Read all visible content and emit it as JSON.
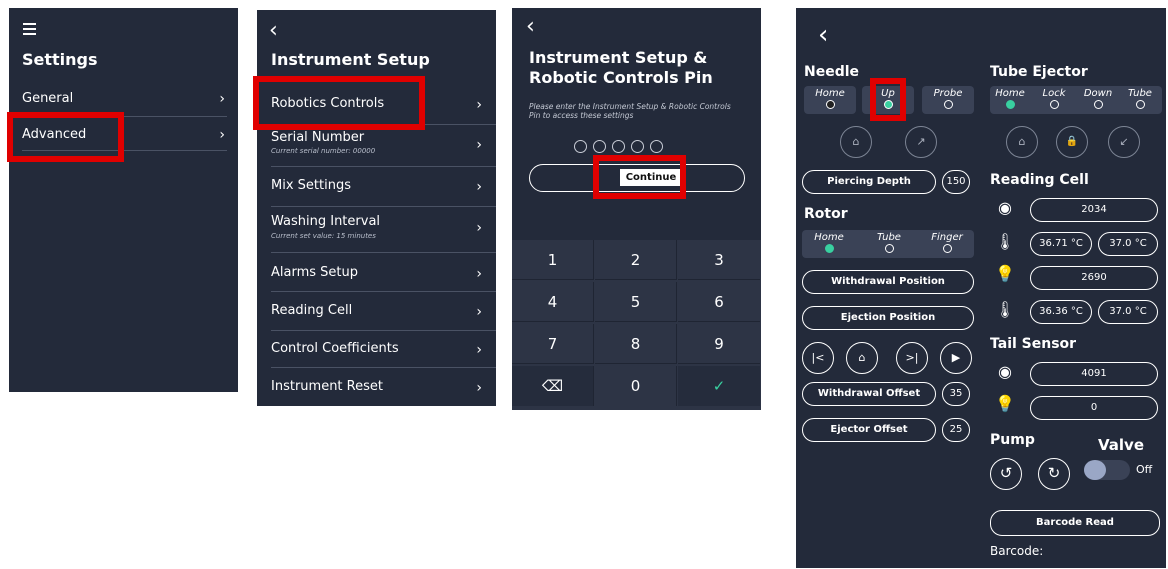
{
  "settings_screen": {
    "menu_icon": "hamburger-icon",
    "title": "Settings",
    "items": [
      {
        "label": "General",
        "chevron": "›"
      },
      {
        "label": "Advanced",
        "chevron": "›"
      }
    ]
  },
  "instrument_setup": {
    "back": "‹",
    "title": "Instrument Setup",
    "items": [
      {
        "label": "Robotics Controls",
        "sub": "",
        "chevron": "›"
      },
      {
        "label": "Serial Number",
        "sub": "Current serial number: 00000",
        "chevron": "›"
      },
      {
        "label": "Mix Settings",
        "sub": "",
        "chevron": "›"
      },
      {
        "label": "Washing Interval",
        "sub": "Current set value: 15 minutes",
        "chevron": "›"
      },
      {
        "label": "Alarms Setup",
        "sub": "",
        "chevron": "›"
      },
      {
        "label": "Reading Cell",
        "sub": "",
        "chevron": "›"
      },
      {
        "label": "Control Coefficients",
        "sub": "",
        "chevron": "›"
      },
      {
        "label": "Instrument Reset",
        "sub": "",
        "chevron": "›"
      }
    ]
  },
  "pin_screen": {
    "back": "‹",
    "title_line1": "Instrument Setup &",
    "title_line2": "Robotic Controls Pin",
    "description": "Please enter the Instrument Setup & Robotic Controls Pin to access these settings",
    "continue_label": "Continue",
    "keys": [
      "1",
      "2",
      "3",
      "4",
      "5",
      "6",
      "7",
      "8",
      "9",
      "⌫",
      "0",
      "✓"
    ]
  },
  "robotics": {
    "back": "‹",
    "needle": {
      "title": "Needle",
      "positions": [
        "Home",
        "Up",
        "Probe"
      ],
      "home_icon": "⌂",
      "up_icon": "↗"
    },
    "tube_ejector": {
      "title": "Tube Ejector",
      "positions": [
        "Home",
        "Lock",
        "Down",
        "Tube"
      ],
      "home_icon": "⌂",
      "lock_icon": "🔒",
      "down_icon": "↙"
    },
    "piercing_depth": {
      "label": "Piercing Depth",
      "value": "150"
    },
    "rotor": {
      "title": "Rotor",
      "positions": [
        "Home",
        "Tube",
        "Finger"
      ],
      "withdrawal_position": "Withdrawal Position",
      "ejection_position": "Ejection Position",
      "controls": [
        "|<",
        "⌂",
        ">|",
        "▶"
      ]
    },
    "withdrawal_offset": {
      "label": "Withdrawal Offset",
      "value": "35"
    },
    "ejector_offset": {
      "label": "Ejector Offset",
      "value": "25"
    },
    "reading_cell": {
      "title": "Reading Cell",
      "eye_value": "2034",
      "temp1": "36.71 °C",
      "temp1_set": "37.0 °C",
      "light_value": "2690",
      "temp2": "36.36 °C",
      "temp2_set": "37.0 °C"
    },
    "tail_sensor": {
      "title": "Tail Sensor",
      "eye_value": "4091",
      "light_value": "0"
    },
    "pump": {
      "title": "Pump",
      "ccw": "↺",
      "cw": "↻"
    },
    "valve": {
      "title": "Valve",
      "state": "Off"
    },
    "barcode_button": "Barcode Read",
    "barcode_label": "Barcode:"
  },
  "colors": {
    "panel_bg": "#232a3a",
    "highlight": "#e00000",
    "accent": "#39d0a0"
  }
}
